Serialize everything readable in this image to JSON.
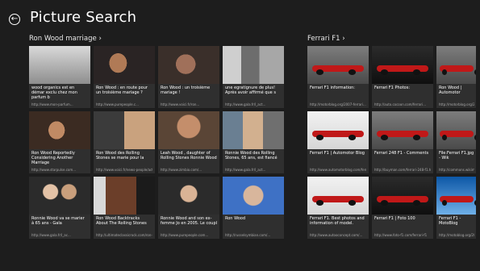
{
  "app": {
    "title": "Picture Search"
  },
  "groups": [
    {
      "title": "Ron Wood marriage ›",
      "tiles": [
        {
          "caption": "wood organics est en démar exclu chez mon parfum b",
          "url": "http://www.mon-parfum..."
        },
        {
          "caption": "Ron Wood : en route pour un troisième mariage ?",
          "url": "http://www.purepeople.c..."
        },
        {
          "caption": "Ron Wood : un troisième mariage !",
          "url": "http://www.voici.fr/ron..."
        },
        {
          "caption": "une egratignure de plus! Après avoir affirmé que s",
          "url": "http://www.gala.fr/l_act..."
        },
        {
          "caption": "Ron Wood Reportedly Considering Another Marriage",
          "url": "http://www.starpulse.com..."
        },
        {
          "caption": "Ron Wood des Rolling Stones se marie pour la",
          "url": "http://www.voici.fr/news-people/actu..."
        },
        {
          "caption": "Leah Wood , daughter of Rolling Stones Ronnie Wood",
          "url": "http://www.zimbio.com/..."
        },
        {
          "caption": "Ronnie Wood des Rolling Stones, 65 ans, est fiancé",
          "url": "http://www.gala.fr/l_act..."
        },
        {
          "caption": "Ronnie Wood va se marier à 65 ans - Gala",
          "url": "http://www.gala.fr/l_ac..."
        },
        {
          "caption": "Ron Wood Backtracks About The Rolling Stones",
          "url": "http://ultimateclassicrock.com/ron-..."
        },
        {
          "caption": "Ronnie Wood and son ex-femme Jo en 2005. Le coupl",
          "url": "http://www.purepeople.com..."
        },
        {
          "caption": "Ron Wood",
          "url": "http://russelsymbian.com/..."
        }
      ]
    },
    {
      "title": "Ferrari F1 ›",
      "tiles": [
        {
          "caption": "Ferrari F1 information:",
          "url": "http://motorblog.org/2007-ferrari..."
        },
        {
          "caption": "Ferrari F1 Photos:",
          "url": "http://auto.cocoon.com/ferrari..."
        },
        {
          "caption": "Ron Wood | Automotor",
          "url": "http://motorblog.org/2008..."
        },
        {
          "caption": "Ferrari F1 | Automotor Blog",
          "url": "http://www.automotorblog.com/ferrari..."
        },
        {
          "caption": "Ferrari 248 F1 - Comments",
          "url": "http://buyman.com/ferrari-248-f1.htm"
        },
        {
          "caption": "File:Ferrari F1.jpg - Wik",
          "url": "http://commons.wikimedia.org"
        },
        {
          "caption": "Ferrari F1. Best photos and information of model.",
          "url": "http://www.autooconcept.com/..."
        },
        {
          "caption": "Ferrari F1 | Foto 100",
          "url": "http://www.foto-f1.com/ferrari-f1"
        },
        {
          "caption": "Ferrari F1 - MotoBlog",
          "url": "http://motoblog.org/2009/0..."
        }
      ]
    }
  ]
}
